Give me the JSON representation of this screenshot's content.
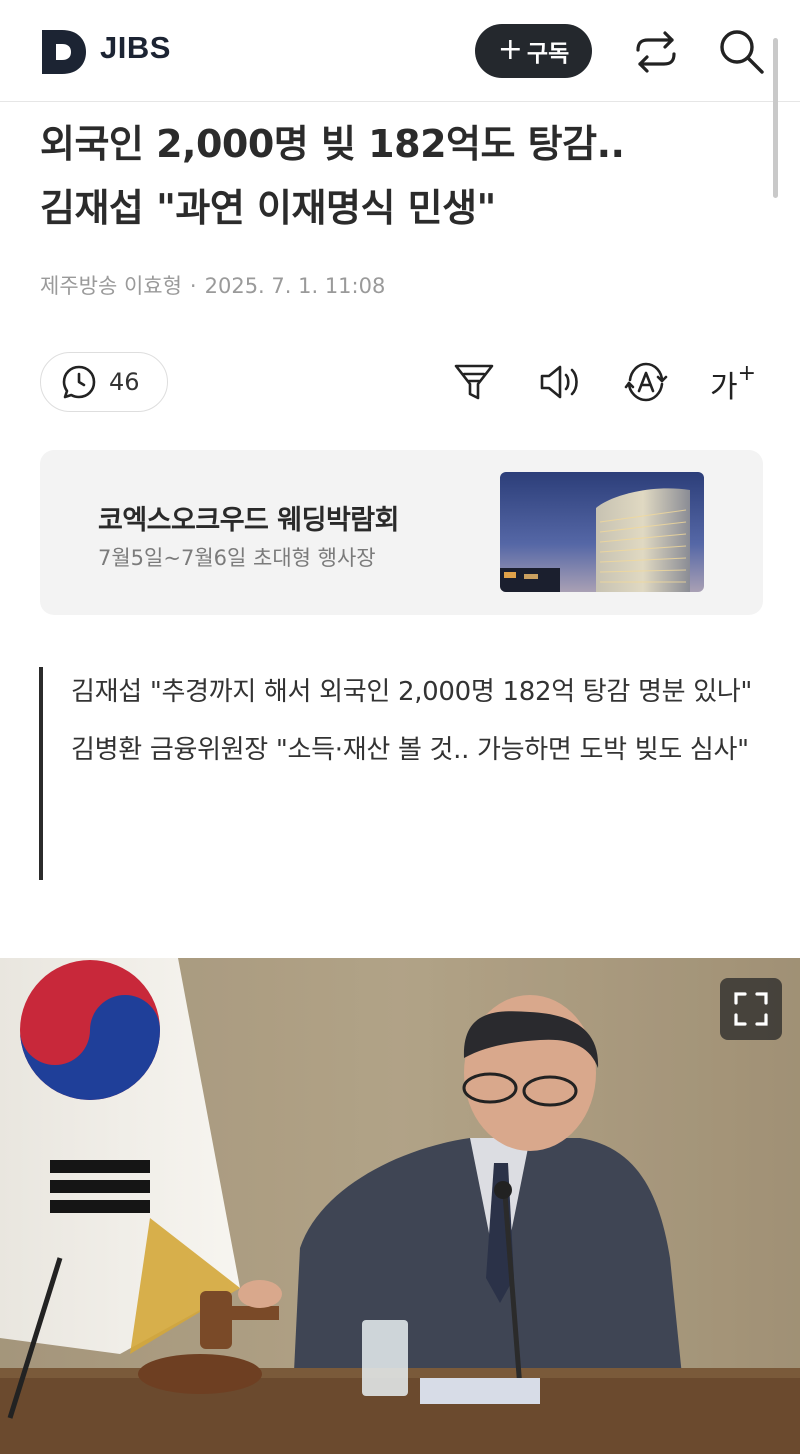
{
  "header": {
    "brand": "JIBS",
    "subscribe_label": "구독",
    "icons": [
      "logo-d-icon",
      "share-icon",
      "search-icon"
    ]
  },
  "article": {
    "title_line1": "외국인 2,000명 빚 182억도 탕감..",
    "title_line2": "김재섭 \"과연 이재명식 민생\"",
    "source": "제주방송 이효형",
    "separator": "·",
    "datetime": "2025. 7. 1. 11:08"
  },
  "toolbar": {
    "comment_count": "46",
    "font_label": "가",
    "font_plus": "+",
    "icons": [
      "comment-icon",
      "filter-icon",
      "speaker-icon",
      "translate-icon",
      "font-size-icon"
    ]
  },
  "ad": {
    "title": "코엑스오크우드 웨딩박람회",
    "subtitle": "7월5일~7월6일 초대형 행사장"
  },
  "summary": {
    "line1": "김재섭 \"추경까지 해서 외국인 2,000명 182억 탕감 명분 있나\"",
    "line2": "김병환 금융위원장 \"소득·재산 볼 것.. 가능하면 도박 빚도 심사\""
  },
  "colors": {
    "brand_dark": "#1c2433",
    "button_dark": "#24282d",
    "meta_gray": "#9a9a9a",
    "card_bg": "#f3f3f3"
  }
}
